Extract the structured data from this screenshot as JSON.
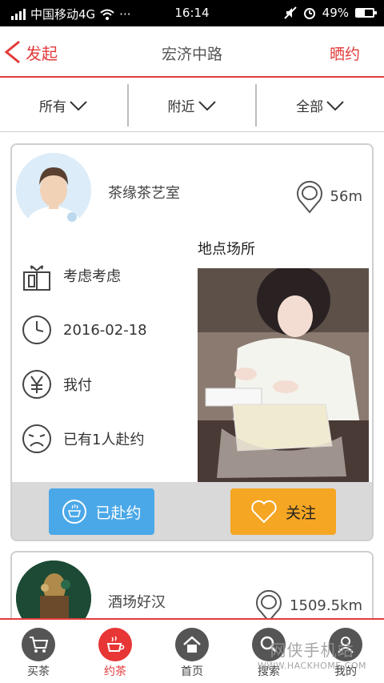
{
  "status_bar": {
    "carrier": "中国移动4G",
    "dots": "···",
    "time": "16:14",
    "battery": "49%",
    "battery_level": 0.49
  },
  "header": {
    "back_label": "发起",
    "title": "宏济中路",
    "right_label": "晒约",
    "accent_color": "#e23b3b"
  },
  "filters": [
    {
      "label": "所有"
    },
    {
      "label": "附近"
    },
    {
      "label": "全部"
    }
  ],
  "cards": [
    {
      "shop_name": "茶缘茶艺室",
      "distance": "56m",
      "subtitle": "地点场所",
      "rows": [
        {
          "icon": "gift-icon",
          "text": "考虑考虑"
        },
        {
          "icon": "clock-icon",
          "text": "2016-02-18"
        },
        {
          "icon": "yen-icon",
          "text": "我付"
        },
        {
          "icon": "face-icon",
          "text": "已有1人赴约"
        }
      ],
      "joined_button": "已赴约",
      "follow_button": "关注",
      "joined_color": "#4ba8e8",
      "follow_color": "#f5a623"
    },
    {
      "shop_name": "酒场好汉",
      "distance": "1509.5km"
    }
  ],
  "tabs": [
    {
      "label": "买茶",
      "icon": "cart-icon",
      "active": false
    },
    {
      "label": "约茶",
      "icon": "teacup-icon",
      "active": true
    },
    {
      "label": "首页",
      "icon": "home-icon",
      "active": false
    },
    {
      "label": "搜索",
      "icon": "search-icon",
      "active": false
    },
    {
      "label": "我的",
      "icon": "profile-icon",
      "active": false
    }
  ],
  "watermark": {
    "text": "网侠手机站",
    "url": "WWW.HACKHOME.COM"
  }
}
